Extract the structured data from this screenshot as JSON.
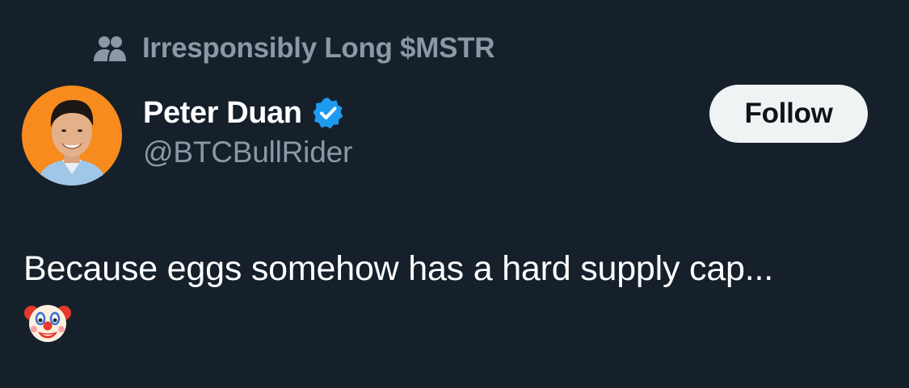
{
  "social_context": {
    "icon": "community-icon",
    "label": "Irresponsibly Long $MSTR"
  },
  "author": {
    "avatar": "profile-photo",
    "display_name": "Peter Duan",
    "verified_icon": "verified-badge-icon",
    "handle": "@BTCBullRider"
  },
  "follow_button": {
    "label": "Follow"
  },
  "tweet": {
    "text": "Because eggs somehow has a hard supply cap...",
    "emoji": "clown-face-emoji"
  },
  "colors": {
    "background": "#15202b",
    "muted_text": "#8b98a5",
    "primary_text": "#ffffff",
    "verified_blue": "#1d9bf0",
    "avatar_orange": "#f78b1d",
    "button_bg": "#eff3f4"
  }
}
